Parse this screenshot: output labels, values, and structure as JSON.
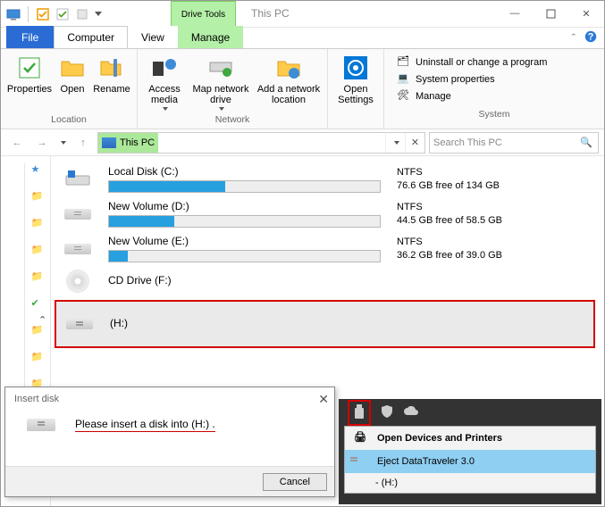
{
  "title": "This PC",
  "toolTab": "Drive Tools",
  "tabs": {
    "file": "File",
    "computer": "Computer",
    "view": "View",
    "manage": "Manage"
  },
  "ribbon": {
    "location": {
      "label": "Location",
      "properties": "Properties",
      "open": "Open",
      "rename": "Rename"
    },
    "network": {
      "label": "Network",
      "access": "Access media",
      "map": "Map network drive",
      "add": "Add a network location"
    },
    "open": {
      "settings": "Open Settings"
    },
    "system": {
      "label": "System",
      "uninstall": "Uninstall or change a program",
      "sysprops": "System properties",
      "manage": "Manage"
    }
  },
  "address": {
    "path": "This PC"
  },
  "search": {
    "placeholder": "Search This PC"
  },
  "drives": [
    {
      "name": "Local Disk (C:)",
      "fs": "NTFS",
      "free": "76.6 GB free of 134 GB",
      "fill": 43
    },
    {
      "name": "New Volume (D:)",
      "fs": "NTFS",
      "free": "44.5 GB free of 58.5 GB",
      "fill": 24
    },
    {
      "name": "New Volume (E:)",
      "fs": "NTFS",
      "free": "36.2 GB free of 39.0 GB",
      "fill": 7
    }
  ],
  "cd": {
    "name": "CD Drive (F:)"
  },
  "h": {
    "name": "(H:)"
  },
  "dialog": {
    "title": "Insert disk",
    "msg": "Please insert a disk into  (H:) .",
    "cancel": "Cancel"
  },
  "menu": {
    "open": "Open Devices and Printers",
    "eject": "Eject DataTraveler 3.0",
    "h": "-    (H:)"
  }
}
